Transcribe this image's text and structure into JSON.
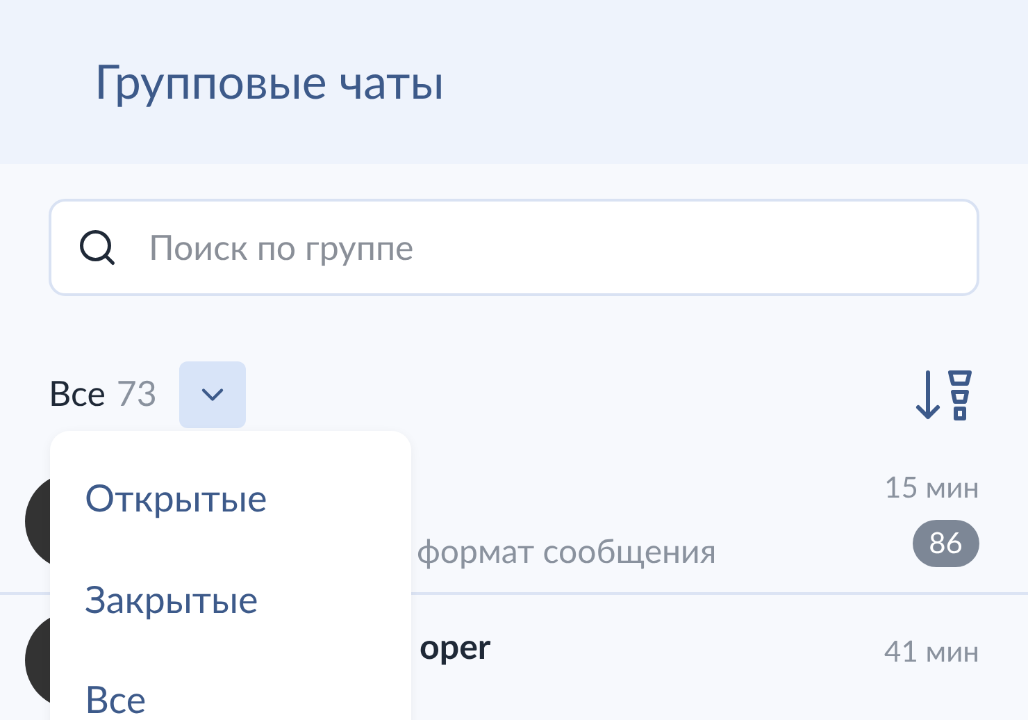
{
  "header": {
    "title": "Групповые чаты"
  },
  "search": {
    "placeholder": "Поиск по группе"
  },
  "filter": {
    "label": "Все",
    "count": "73",
    "expanded": true
  },
  "dropdown": {
    "options": [
      {
        "label": "Открытые"
      },
      {
        "label": "Закрытые"
      },
      {
        "label": "Все"
      }
    ]
  },
  "chats": [
    {
      "preview": "формат сообщения",
      "time": "15 мин",
      "unread": "86"
    },
    {
      "name": "oper",
      "time": "41 мин"
    }
  ]
}
